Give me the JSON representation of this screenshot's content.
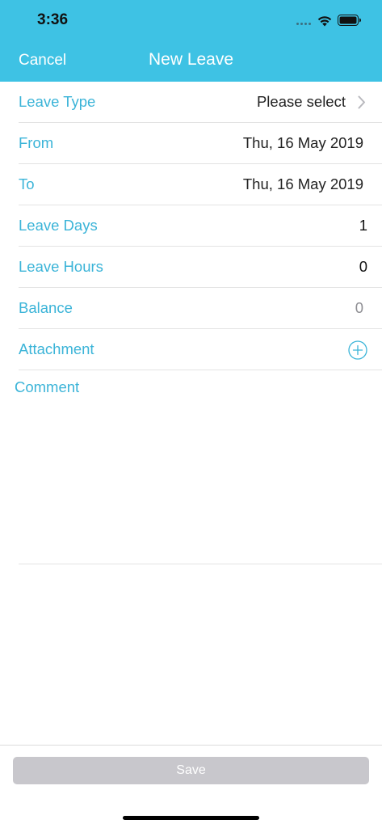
{
  "status_bar": {
    "time": "3:36",
    "icons": [
      "signal-dots-icon",
      "wifi-icon",
      "battery-icon"
    ]
  },
  "nav": {
    "cancel_label": "Cancel",
    "title": "New Leave"
  },
  "form": {
    "leave_type": {
      "label": "Leave Type",
      "value": "Please select"
    },
    "from": {
      "label": "From",
      "value": "Thu, 16 May 2019"
    },
    "to": {
      "label": "To",
      "value": "Thu, 16 May 2019"
    },
    "leave_days": {
      "label": "Leave Days",
      "value": "1"
    },
    "leave_hours": {
      "label": "Leave Hours",
      "value": "0"
    },
    "balance": {
      "label": "Balance",
      "value": "0"
    },
    "attachment": {
      "label": "Attachment",
      "icon": "plus-circle-icon"
    },
    "comment": {
      "label": "Comment",
      "value": ""
    }
  },
  "footer": {
    "save_label": "Save"
  },
  "colors": {
    "header_bg": "#3ec2e4",
    "accent": "#3bb4d8",
    "save_disabled_bg": "#c8c7cc"
  }
}
